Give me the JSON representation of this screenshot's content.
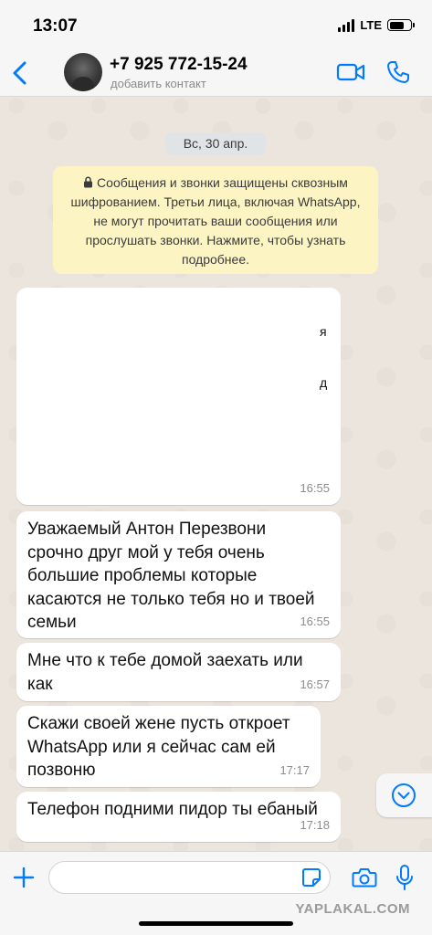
{
  "status_bar": {
    "time": "13:07",
    "network": "LTE",
    "battery_level": 0.72
  },
  "header": {
    "contact_name": "+7 925 772-15-24",
    "contact_subtitle": "добавить контакт",
    "icons": [
      "chevron-left-icon",
      "avatar",
      "video-camera-icon",
      "phone-icon"
    ],
    "accent_color": "#007aff"
  },
  "chat": {
    "date_label": "Вс, 30 апр.",
    "encryption_notice": "Сообщения и звонки защищены сквозным шифрованием. Третьи лица, включая WhatsApp, не могут прочитать ваши сообщения или прослушать звонки. Нажмите, чтобы узнать подробнее.",
    "redacted_message": {
      "time": "16:55",
      "fragments": [
        "я",
        "д"
      ]
    },
    "messages": [
      {
        "text": "Уважаемый Антон Перезвони\nсрочно друг мой у тебя очень\nбольшие проблемы которые\nкасаются не только тебя но и твоей\nсемьи",
        "time": "16:55"
      },
      {
        "text": "Мне что к тебе домой заехать или\nкак",
        "time": "16:57"
      },
      {
        "text": "Скажи своей жене пусть откроет\nWhatsApp или я сейчас сам ей\nпозвоню",
        "time": "17:17"
      },
      {
        "text": "Телефон подними пидор ты ебаный",
        "time": "17:18"
      }
    ]
  },
  "input_bar": {
    "placeholder": "",
    "watermark": "YAPLAKAL.COM"
  }
}
